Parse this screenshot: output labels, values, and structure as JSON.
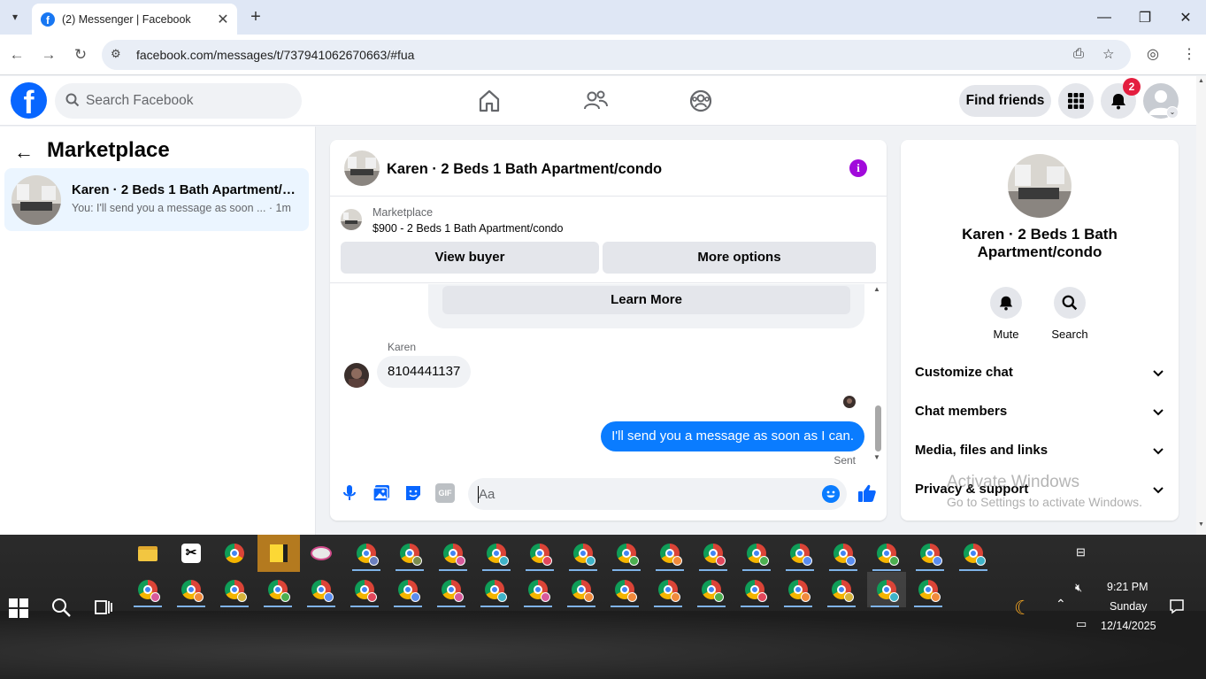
{
  "browser": {
    "tab_title": "(2) Messenger | Facebook",
    "url": "facebook.com/messages/t/737941062670663/#fua"
  },
  "fb": {
    "search_placeholder": "Search Facebook",
    "find_friends": "Find friends",
    "notifications_count": "2"
  },
  "left": {
    "title": "Marketplace",
    "conversations": [
      {
        "name": "Karen · 2 Beds 1 Bath Apartment/condo",
        "name_display": "Karen · 2 Beds 1 Bath Apartment/c...",
        "preview": "You: I'll send you a message as soon ... · 1m"
      }
    ]
  },
  "chat": {
    "title": "Karen · 2 Beds 1 Bath Apartment/condo",
    "marketplace_label": "Marketplace",
    "listing": "$900 - 2 Beds 1 Bath Apartment/condo",
    "view_buyer": "View buyer",
    "more_options": "More options",
    "learn_more": "Learn More",
    "sender_name": "Karen",
    "incoming_message": "8104441137",
    "outgoing_message": "I'll send you a message as soon as I can.",
    "status": "Sent",
    "composer_placeholder": "Aa",
    "gif_label": "GIF"
  },
  "right": {
    "name": "Karen · 2 Beds 1 Bath Apartment/condo",
    "actions": [
      "Mute",
      "Search"
    ],
    "sections": [
      "Customize chat",
      "Chat members",
      "Media, files and links",
      "Privacy & support"
    ]
  },
  "watermark": {
    "line1": "Activate Windows",
    "line2": "Go to Settings to activate Windows."
  },
  "taskbar": {
    "time": "9:21 PM",
    "day": "Sunday",
    "date": "12/14/2025"
  },
  "colors": {
    "fb_blue": "#0866ff",
    "bubble_blue": "#0a7cff",
    "info_purple": "#a10adb",
    "badge_red": "#e41e3f"
  }
}
